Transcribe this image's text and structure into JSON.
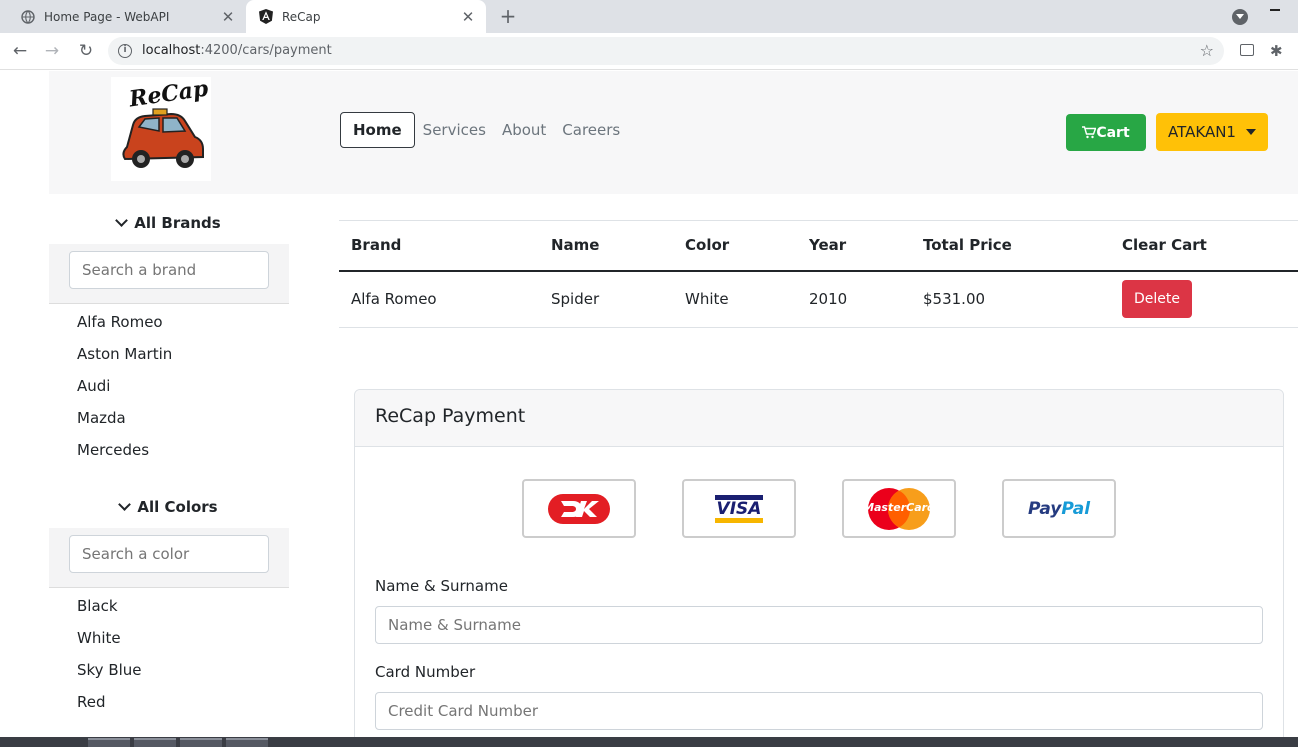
{
  "browser": {
    "tabs": [
      {
        "title": "Home Page - WebAPI",
        "icon": "globe-icon",
        "active": false
      },
      {
        "title": "ReCap",
        "icon": "angular-icon",
        "active": true
      }
    ],
    "url_host": "localhost",
    "url_path": ":4200/cars/payment"
  },
  "header": {
    "logo_text": "ReCap",
    "nav": [
      "Home",
      "Services",
      "About",
      "Careers"
    ],
    "cart_label": "Cart",
    "user_label": "ATAKAN1"
  },
  "sidebar": {
    "brands_title": "All Brands",
    "brand_search_placeholder": "Search a brand",
    "brands": [
      "Alfa Romeo",
      "Aston Martin",
      "Audi",
      "Mazda",
      "Mercedes"
    ],
    "colors_title": "All Colors",
    "color_search_placeholder": "Search a color",
    "colors": [
      "Black",
      "White",
      "Sky Blue",
      "Red"
    ]
  },
  "cart": {
    "columns": [
      "Brand",
      "Name",
      "Color",
      "Year",
      "Total Price",
      "Clear Cart"
    ],
    "rows": [
      {
        "brand": "Alfa Romeo",
        "name": "Spider",
        "color": "White",
        "year": "2010",
        "price": "$531.00",
        "action": "Delete"
      }
    ]
  },
  "payment": {
    "title": "ReCap Payment",
    "card_brands": [
      "dankort-icon",
      "visa-icon",
      "mastercard-icon",
      "paypal-icon"
    ],
    "visa_text": "VISA",
    "mastercard_text": "MasterCard",
    "paypal_text_a": "Pay",
    "paypal_text_b": "Pal",
    "name_label": "Name & Surname",
    "name_placeholder": "Name & Surname",
    "card_label": "Card Number",
    "card_placeholder": "Credit Card Number"
  },
  "colors": {
    "success": "#28a745",
    "warning": "#ffc107",
    "danger": "#dc3545"
  }
}
